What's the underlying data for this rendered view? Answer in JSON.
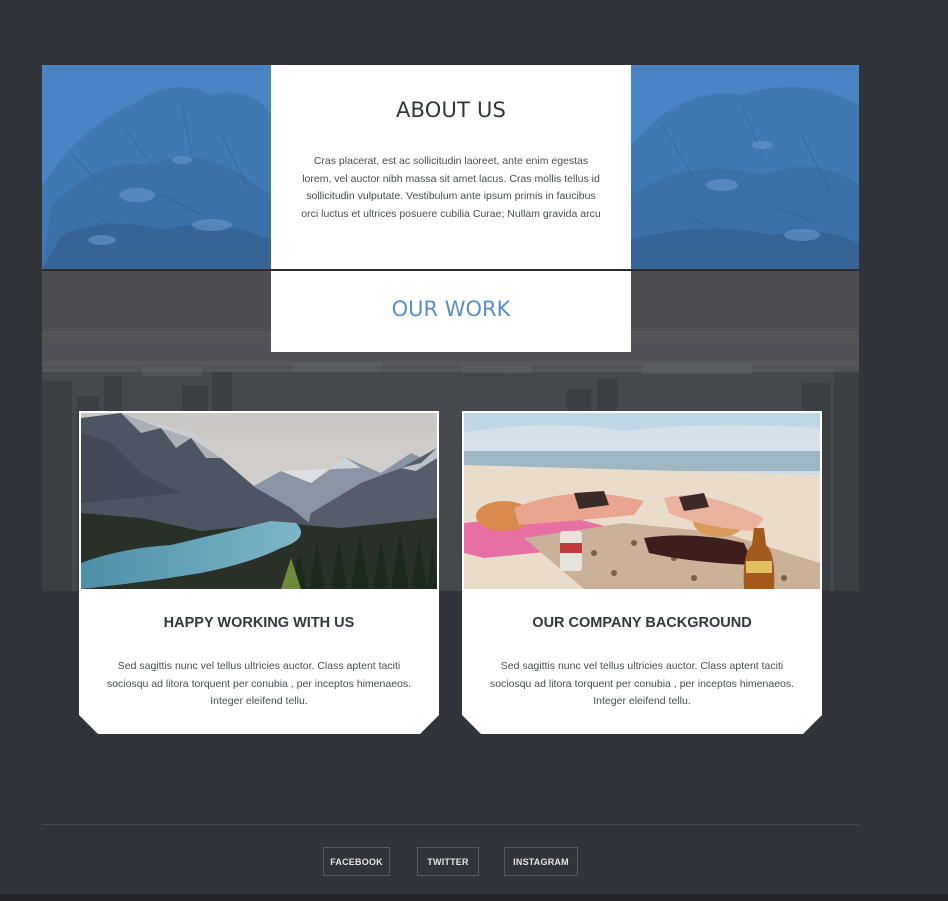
{
  "about": {
    "title": "ABOUT US",
    "text": "Cras placerat, est ac sollicitudin laoreet, ante enim egestas lorem, vel auctor nibh massa sit amet lacus. Cras mollis tellus id sollicitudin vulputate. Vestibulum ante ipsum primis in faucibus orci luctus et ultrices posuere cubilia Curae; Nullam gravida arcu"
  },
  "work": {
    "title": "OUR WORK",
    "projects": [
      {
        "title": "HAPPY WORKING WITH US",
        "text": "Sed sagittis nunc vel tellus ultricies auctor. Class aptent taciti sociosqu ad litora torquent per conubia , per inceptos himenaeos. Integer eleifend tellu.",
        "image": "mountain-lake-photo"
      },
      {
        "title": "OUR COMPANY BACKGROUND",
        "text": "Sed sagittis nunc vel tellus ultricies auctor. Class aptent taciti sociosqu ad litora torquent per conubia , per inceptos himenaeos. Integer eleifend tellu.",
        "image": "beach-sunbathing-photo"
      }
    ]
  },
  "footer": {
    "social": [
      "FACEBOOK",
      "TWITTER",
      "INSTAGRAM"
    ]
  },
  "colors": {
    "page_bg": "#31343a",
    "about_overlay": "#4a84c4",
    "accent": "#5a8fc8",
    "work_overlay": "#4c4e52",
    "card_bg": "#ffffff"
  }
}
